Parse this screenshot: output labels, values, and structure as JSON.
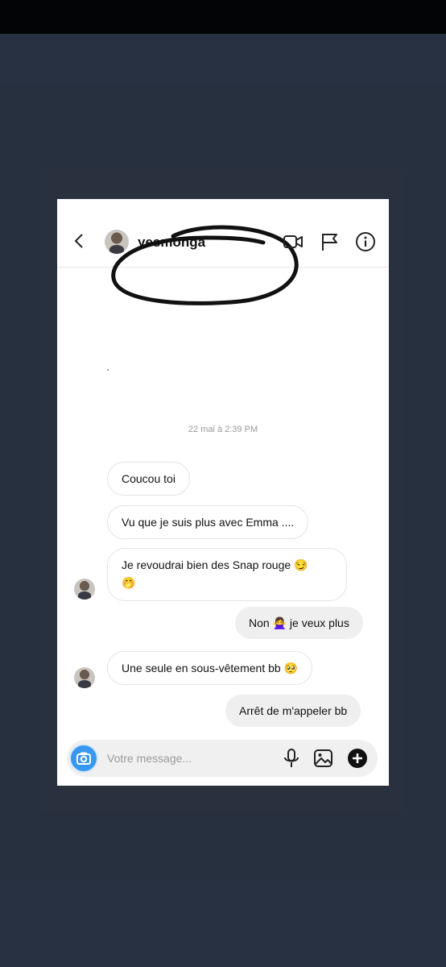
{
  "header": {
    "username": "yesmonga"
  },
  "timestamp": "22 mai à 2:39 PM",
  "messages": [
    {
      "side": "in",
      "text": "Coucou toi"
    },
    {
      "side": "in",
      "text": "Vu que je suis plus avec Emma ...."
    },
    {
      "side": "in",
      "text": "Je revoudrai bien des Snap rouge",
      "emoji": "😏",
      "line2_emoji": "🤭"
    },
    {
      "side": "out",
      "text_before": "Non",
      "emoji": "🙅‍♀️",
      "text_after": "je veux plus"
    },
    {
      "side": "in",
      "text": "Une seule en sous-vêtement bb",
      "emoji": "🥺"
    },
    {
      "side": "out",
      "text": "Arrêt de m'appeler bb"
    }
  ],
  "composer": {
    "placeholder": "Votre message..."
  },
  "icons": [
    "back-arrow-icon",
    "video-call-icon",
    "flag-icon",
    "info-icon",
    "camera-icon",
    "microphone-icon",
    "gallery-icon",
    "plus-icon"
  ],
  "colors": {
    "accent": "#3897f0",
    "background": "#283142",
    "outgoing_bubble": "#efefef"
  }
}
